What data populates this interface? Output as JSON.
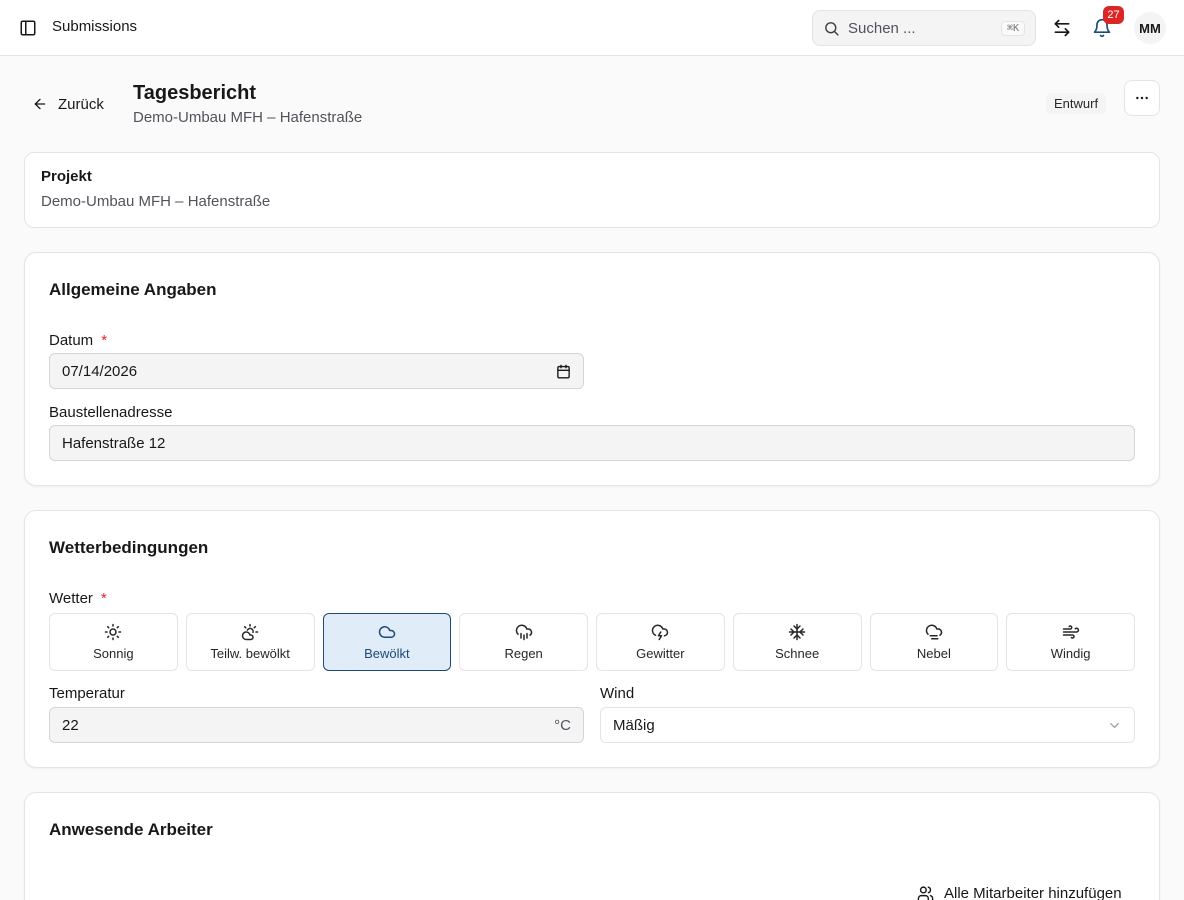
{
  "topbar": {
    "title": "Submissions",
    "search_placeholder": "Suchen ...",
    "search_shortcut": "⌘K",
    "notification_count": "27",
    "avatar_initials": "MM"
  },
  "header": {
    "back_label": "Zurück",
    "title": "Tagesbericht",
    "subtitle": "Demo-Umbau MFH – Hafenstraße",
    "status": "Entwurf"
  },
  "project": {
    "label": "Projekt",
    "value": "Demo-Umbau MFH – Hafenstraße"
  },
  "general": {
    "heading": "Allgemeine Angaben",
    "date_label": "Datum",
    "date_value": "07/14/2026",
    "address_label": "Baustellenadresse",
    "address_value": "Hafenstraße 12",
    "required_mark": "*"
  },
  "weather": {
    "heading": "Wetterbedingungen",
    "label": "Wetter",
    "required_mark": "*",
    "options": [
      {
        "label": "Sonnig",
        "icon": "sun-icon"
      },
      {
        "label": "Teilw. bewölkt",
        "icon": "cloud-sun-icon"
      },
      {
        "label": "Bewölkt",
        "icon": "cloud-icon"
      },
      {
        "label": "Regen",
        "icon": "cloud-rain-icon"
      },
      {
        "label": "Gewitter",
        "icon": "cloud-lightning-icon"
      },
      {
        "label": "Schnee",
        "icon": "snowflake-icon"
      },
      {
        "label": "Nebel",
        "icon": "cloud-fog-icon"
      },
      {
        "label": "Windig",
        "icon": "wind-icon"
      }
    ],
    "selected": "Bewölkt",
    "temperature_label": "Temperatur",
    "temperature_value": "22",
    "temperature_unit": "°C",
    "wind_label": "Wind",
    "wind_value": "Mäßig"
  },
  "workers": {
    "heading": "Anwesende Arbeiter",
    "add_all_label": "Alle Mitarbeiter hinzufügen"
  },
  "colors": {
    "accent": "#1e4a78",
    "accent_bg": "#e0ecf8",
    "required": "#dc2626",
    "badge": "#dc2626"
  }
}
